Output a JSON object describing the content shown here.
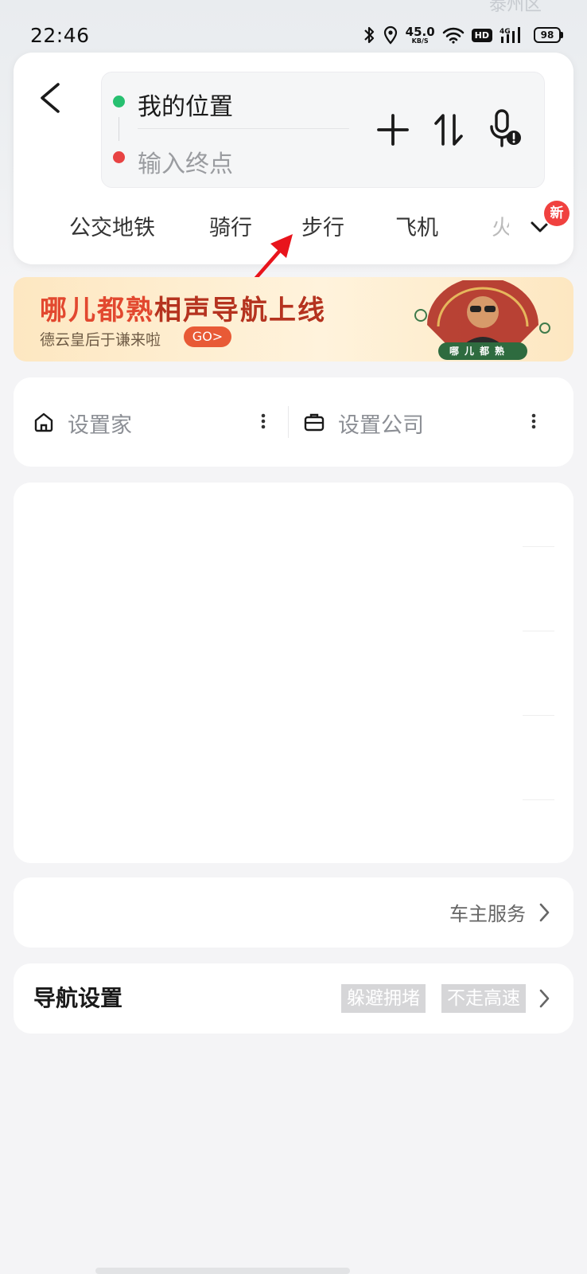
{
  "status_bar": {
    "time": "22:46",
    "net_speed_value": "45.0",
    "net_speed_unit": "KB/S",
    "hd_label": "HD",
    "cell_label": "4G",
    "battery_level": "98"
  },
  "map": {
    "labels": [
      "泰州区"
    ]
  },
  "route": {
    "start_value": "我的位置",
    "end_placeholder": "输入终点",
    "tabs": [
      "公交地铁",
      "骑行",
      "步行",
      "飞机",
      "火"
    ],
    "new_badge": "新"
  },
  "banner": {
    "title_highlight": "哪儿都熟",
    "title_rest": "相声导航上线",
    "subtitle": "德云皇后于谦来啦",
    "go_label": "GO>",
    "badge_text": "哪儿都熟"
  },
  "shortcuts": {
    "home_label": "设置家",
    "company_label": "设置公司"
  },
  "car_service": {
    "label": "车主服务"
  },
  "nav_settings": {
    "title": "导航设置",
    "chips": [
      "躲避拥堵",
      "不走高速"
    ]
  },
  "colors": {
    "start_dot": "#27c070",
    "end_dot": "#e84343",
    "badge": "#f0413f",
    "banner_accent": "#e2482f",
    "arrow_annotation": "#e8141c"
  }
}
